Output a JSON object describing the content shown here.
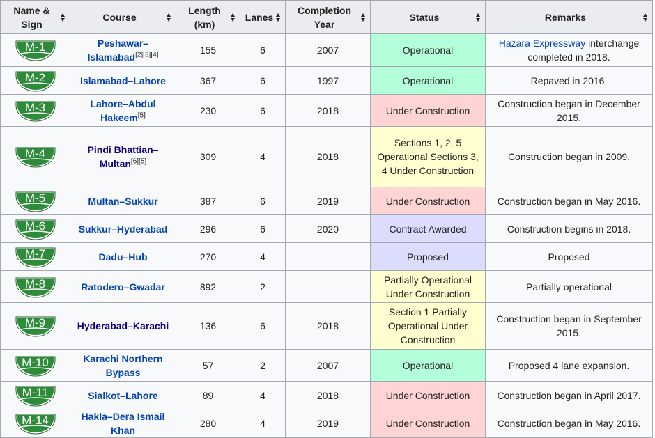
{
  "headers": {
    "name": "Name & Sign",
    "course": "Course",
    "length": "Length (km)",
    "lanes": "Lanes",
    "year": "Completion Year",
    "status": "Status",
    "remarks": "Remarks"
  },
  "colors": {
    "operational": "#b3ffd9",
    "under_construction": "#ffd4d4",
    "partial": "#ffffd0",
    "proposed": "#dcdcfe",
    "sign_green": "#2e8b3a"
  },
  "rows": [
    {
      "sign": "M-1",
      "course": "Peshawar–Islamabad",
      "refs": "[2][3][4]",
      "length": "155",
      "lanes": "6",
      "year": "2007",
      "status": "Operational",
      "status_kind": "operational",
      "remark_link": "Hazara Expressway",
      "remarks": " interchange completed in 2018."
    },
    {
      "sign": "M-2",
      "course": "Islamabad–Lahore",
      "refs": "",
      "length": "367",
      "lanes": "6",
      "year": "1997",
      "status": "Operational",
      "status_kind": "operational",
      "remark_link": "",
      "remarks": "Repaved in 2016."
    },
    {
      "sign": "M-3",
      "course": "Lahore–Abdul Hakeem",
      "refs": "[5]",
      "length": "230",
      "lanes": "6",
      "year": "2018",
      "status": "Under Construction",
      "status_kind": "construction",
      "remark_link": "",
      "remarks": "Construction began in December 2015."
    },
    {
      "sign": "M-4",
      "course": "Pindi Bhattian–Multan",
      "refs": "[6][5]",
      "length": "309",
      "lanes": "4",
      "year": "2018",
      "status": "Sections 1, 2, 5 Operational Sections 3, 4 Under Construction",
      "status_kind": "partial",
      "remark_link": "",
      "remarks": "Construction began in 2009."
    },
    {
      "sign": "M-5",
      "course": "Multan–Sukkur",
      "refs": "",
      "length": "387",
      "lanes": "6",
      "year": "2019",
      "status": "Under Construction",
      "status_kind": "construction",
      "remark_link": "",
      "remarks": "Construction began in May 2016."
    },
    {
      "sign": "M-6",
      "course": "Sukkur–Hyderabad",
      "refs": "",
      "length": "296",
      "lanes": "6",
      "year": "2020",
      "status": "Contract Awarded",
      "status_kind": "proposed",
      "remark_link": "",
      "remarks": "Construction begins in 2018."
    },
    {
      "sign": "M-7",
      "course": "Dadu–Hub",
      "refs": "",
      "length": "270",
      "lanes": "4",
      "year": "",
      "status": "Proposed",
      "status_kind": "proposed",
      "remark_link": "",
      "remarks": "Proposed"
    },
    {
      "sign": "M-8",
      "course": "Ratodero–Gwadar",
      "refs": "",
      "length": "892",
      "lanes": "2",
      "year": "",
      "status": "Partially Operational Under Construction",
      "status_kind": "partial",
      "remark_link": "",
      "remarks": "Partially operational"
    },
    {
      "sign": "M-9",
      "course": "Hyderabad–Karachi",
      "refs": "",
      "length": "136",
      "lanes": "6",
      "year": "2018",
      "status": "Section 1 Partially Operational Under Construction",
      "status_kind": "partial",
      "remark_link": "",
      "remarks": "Construction began in September 2015."
    },
    {
      "sign": "M-10",
      "course": "Karachi Northern Bypass",
      "refs": "",
      "length": "57",
      "lanes": "2",
      "year": "2007",
      "status": "Operational",
      "status_kind": "operational",
      "remark_link": "",
      "remarks": "Proposed 4 lane expansion."
    },
    {
      "sign": "M-11",
      "course": "Sialkot–Lahore",
      "refs": "",
      "length": "89",
      "lanes": "4",
      "year": "2018",
      "status": "Under Construction",
      "status_kind": "construction",
      "remark_link": "",
      "remarks": "Construction began in April 2017."
    },
    {
      "sign": "M-14",
      "course": "Hakla–Dera Ismail Khan",
      "refs": "",
      "length": "280",
      "lanes": "4",
      "year": "2019",
      "status": "Under Construction",
      "status_kind": "construction",
      "remark_link": "",
      "remarks": "Construction began in May 2016."
    }
  ]
}
